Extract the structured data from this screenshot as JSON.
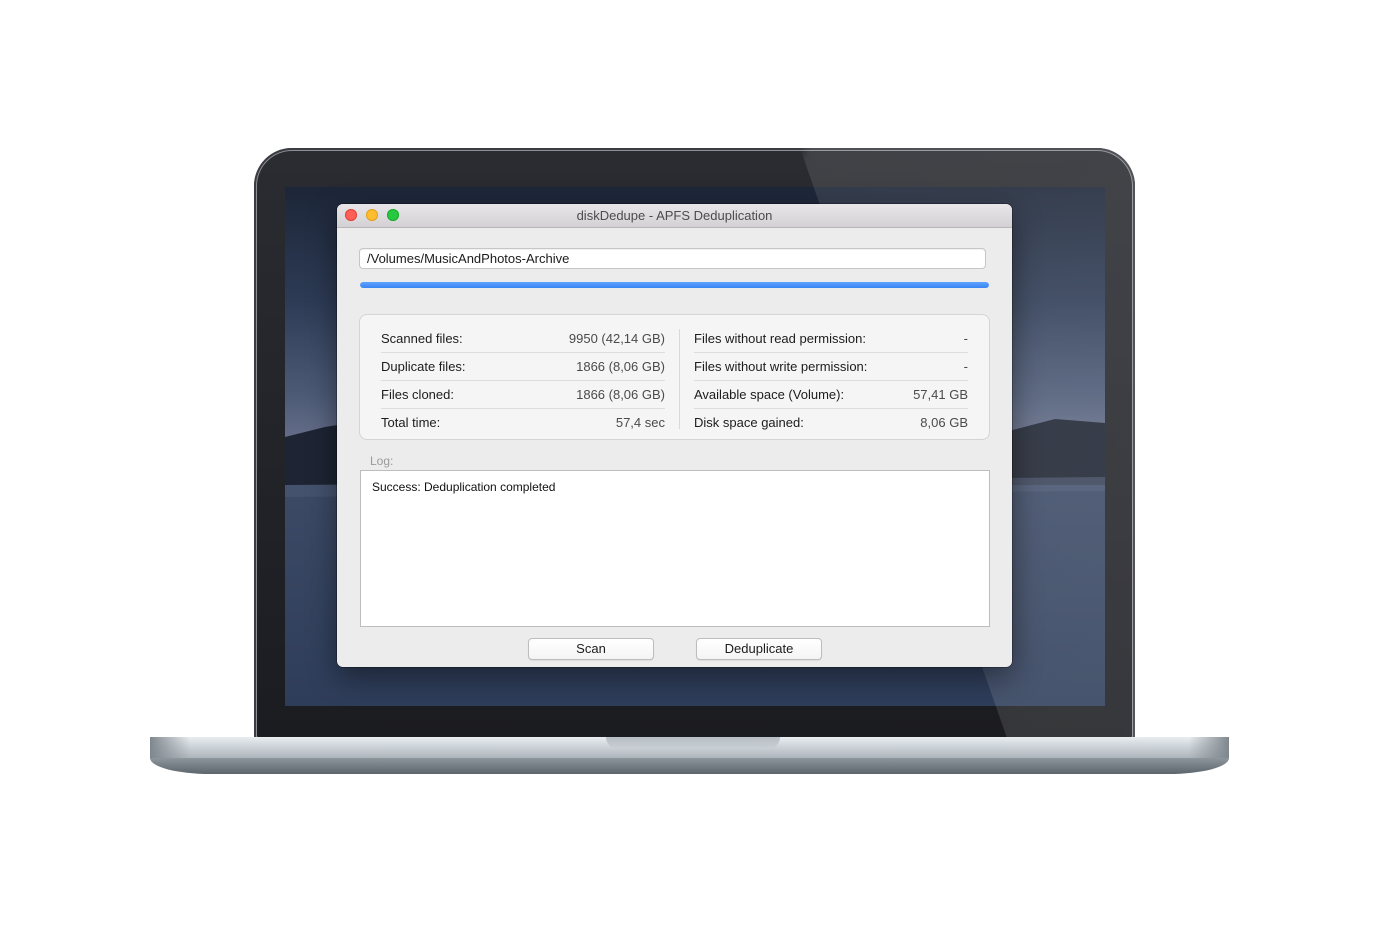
{
  "window": {
    "title": "diskDedupe - APFS Deduplication"
  },
  "path_field": {
    "value": "/Volumes/MusicAndPhotos-Archive"
  },
  "progress": {
    "fraction": 1.0,
    "color": "#3a85f3"
  },
  "stats": {
    "left": [
      {
        "label": "Scanned files:",
        "value": "9950 (42,14 GB)"
      },
      {
        "label": "Duplicate files:",
        "value": "1866 (8,06 GB)"
      },
      {
        "label": "Files cloned:",
        "value": "1866 (8,06 GB)"
      },
      {
        "label": "Total time:",
        "value": "57,4  sec"
      }
    ],
    "right": [
      {
        "label": "Files without read permission:",
        "value": "-"
      },
      {
        "label": "Files without write permission:",
        "value": "-"
      },
      {
        "label": "Available space (Volume):",
        "value": "57,41 GB"
      },
      {
        "label": "Disk space gained:",
        "value": "8,06 GB"
      }
    ]
  },
  "log": {
    "label": "Log:",
    "text": "Success: Deduplication completed"
  },
  "buttons": {
    "scan": "Scan",
    "deduplicate": "Deduplicate"
  },
  "traffic_lights": {
    "close": "#fe5f57",
    "minimize": "#febc2e",
    "maximize": "#28c840"
  }
}
